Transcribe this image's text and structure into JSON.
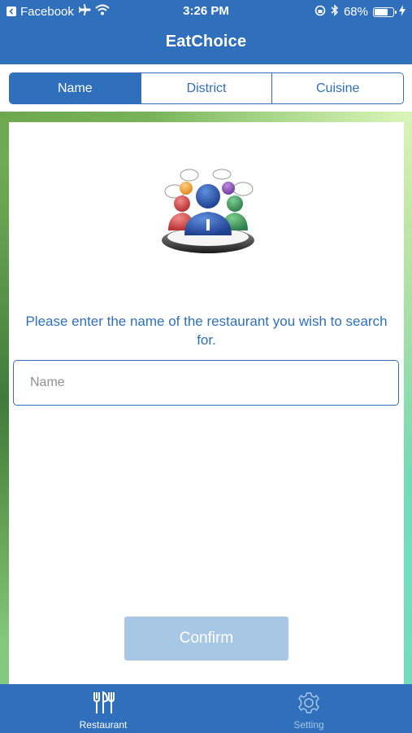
{
  "status_bar": {
    "back_app": "Facebook",
    "time": "3:26 PM",
    "battery_percent": "68%",
    "battery_level": 0.68
  },
  "app": {
    "title": "EatChoice"
  },
  "segments": [
    {
      "label": "Name",
      "selected": true
    },
    {
      "label": "District",
      "selected": false
    },
    {
      "label": "Cuisine",
      "selected": false
    }
  ],
  "main": {
    "prompt": "Please enter the name of the restaurant you wish to search for.",
    "name_input": {
      "placeholder": "Name",
      "value": ""
    },
    "confirm_label": "Confirm",
    "confirm_enabled": false
  },
  "tabbar": {
    "items": [
      {
        "label": "Restaurant",
        "icon": "fork-knife-icon",
        "active": true
      },
      {
        "label": "Setting",
        "icon": "gear-icon",
        "active": false
      }
    ]
  },
  "colors": {
    "primary": "#2f6fbb",
    "disabled_button": "#a8c7e4"
  }
}
